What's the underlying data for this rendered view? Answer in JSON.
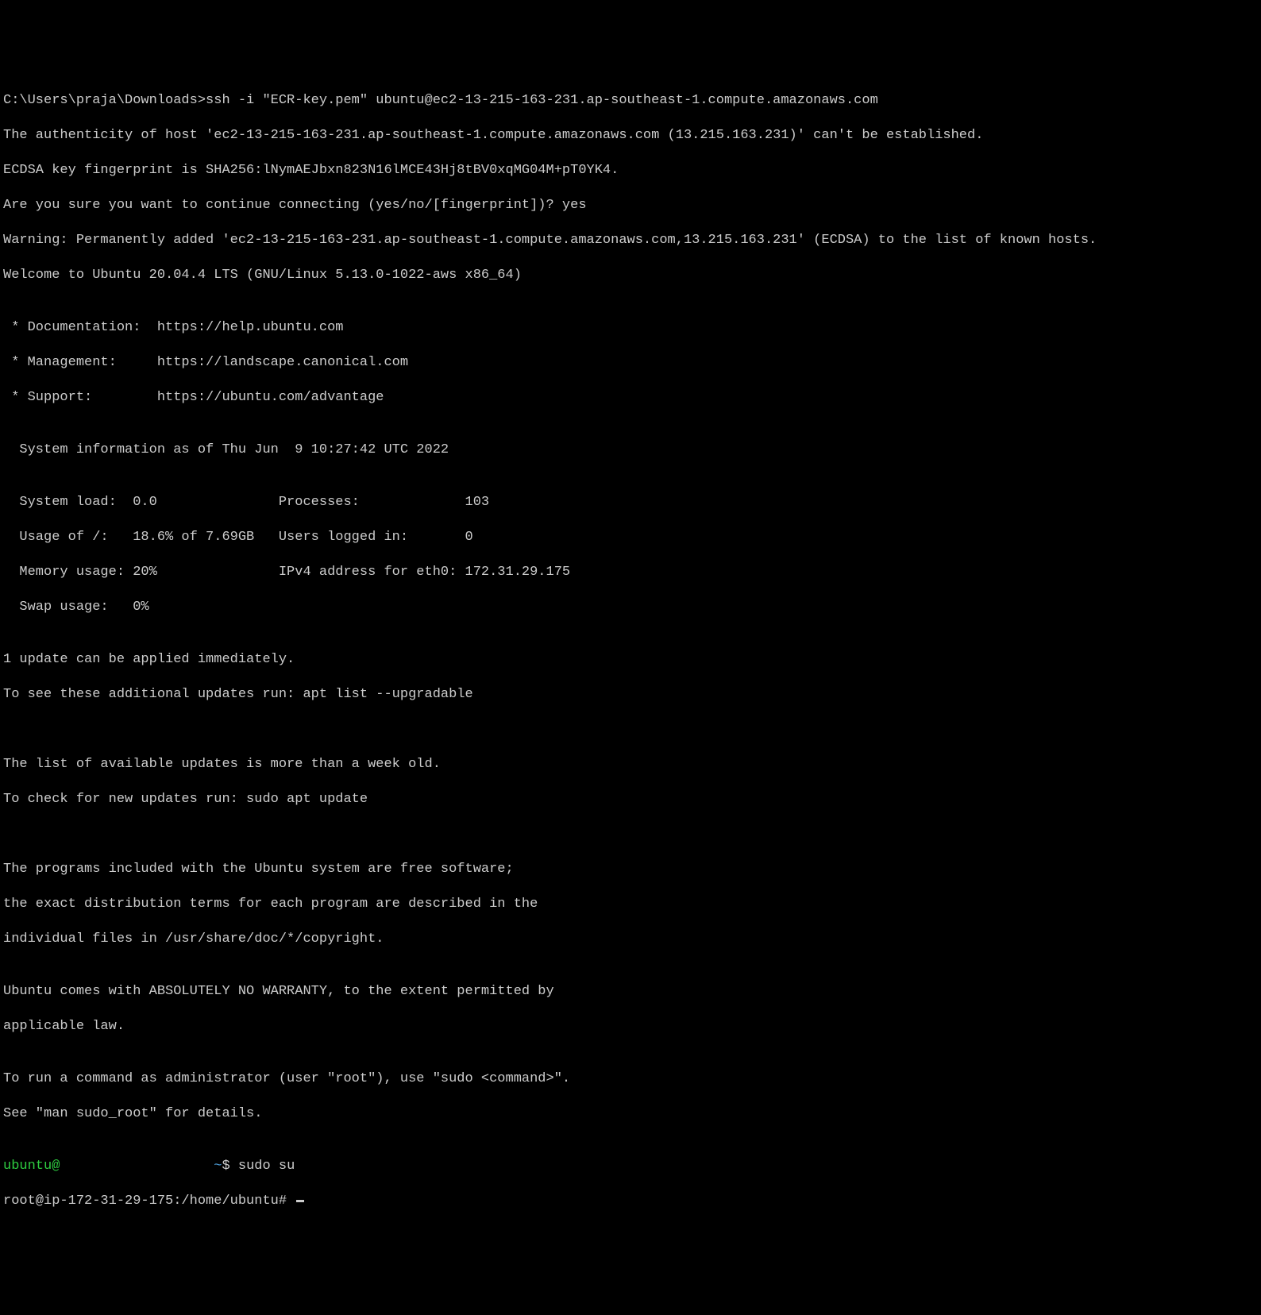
{
  "lines": {
    "l0": "C:\\Users\\praja\\Downloads>ssh -i \"ECR-key.pem\" ubuntu@ec2-13-215-163-231.ap-southeast-1.compute.amazonaws.com",
    "l1": "The authenticity of host 'ec2-13-215-163-231.ap-southeast-1.compute.amazonaws.com (13.215.163.231)' can't be established.",
    "l2": "ECDSA key fingerprint is SHA256:lNymAEJbxn823N16lMCE43Hj8tBV0xqMG04M+pT0YK4.",
    "l3": "Are you sure you want to continue connecting (yes/no/[fingerprint])? yes",
    "l4": "Warning: Permanently added 'ec2-13-215-163-231.ap-southeast-1.compute.amazonaws.com,13.215.163.231' (ECDSA) to the list of known hosts.",
    "l5": "Welcome to Ubuntu 20.04.4 LTS (GNU/Linux 5.13.0-1022-aws x86_64)",
    "l6": "",
    "l7": " * Documentation:  https://help.ubuntu.com",
    "l8": " * Management:     https://landscape.canonical.com",
    "l9": " * Support:        https://ubuntu.com/advantage",
    "l10": "",
    "l11": "  System information as of Thu Jun  9 10:27:42 UTC 2022",
    "l12": "",
    "l13": "  System load:  0.0               Processes:             103",
    "l14": "  Usage of /:   18.6% of 7.69GB   Users logged in:       0",
    "l15": "  Memory usage: 20%               IPv4 address for eth0: 172.31.29.175",
    "l16": "  Swap usage:   0%",
    "l17": "",
    "l18": "1 update can be applied immediately.",
    "l19": "To see these additional updates run: apt list --upgradable",
    "l20": "",
    "l21": "",
    "l22": "The list of available updates is more than a week old.",
    "l23": "To check for new updates run: sudo apt update",
    "l24": "",
    "l25": "",
    "l26": "The programs included with the Ubuntu system are free software;",
    "l27": "the exact distribution terms for each program are described in the",
    "l28": "individual files in /usr/share/doc/*/copyright.",
    "l29": "",
    "l30": "Ubuntu comes with ABSOLUTELY NO WARRANTY, to the extent permitted by",
    "l31": "applicable law.",
    "l32": "",
    "l33": "To run a command as administrator (user \"root\"), use \"sudo <command>\".",
    "l34": "See \"man sudo_root\" for details.",
    "l35": ""
  },
  "prompt1": {
    "user": "ubuntu@",
    "blank": "                   ",
    "path": "~",
    "suffix": "$ sudo su"
  },
  "prompt2": {
    "text": "root@ip-172-31-29-175:/home/ubuntu# "
  }
}
